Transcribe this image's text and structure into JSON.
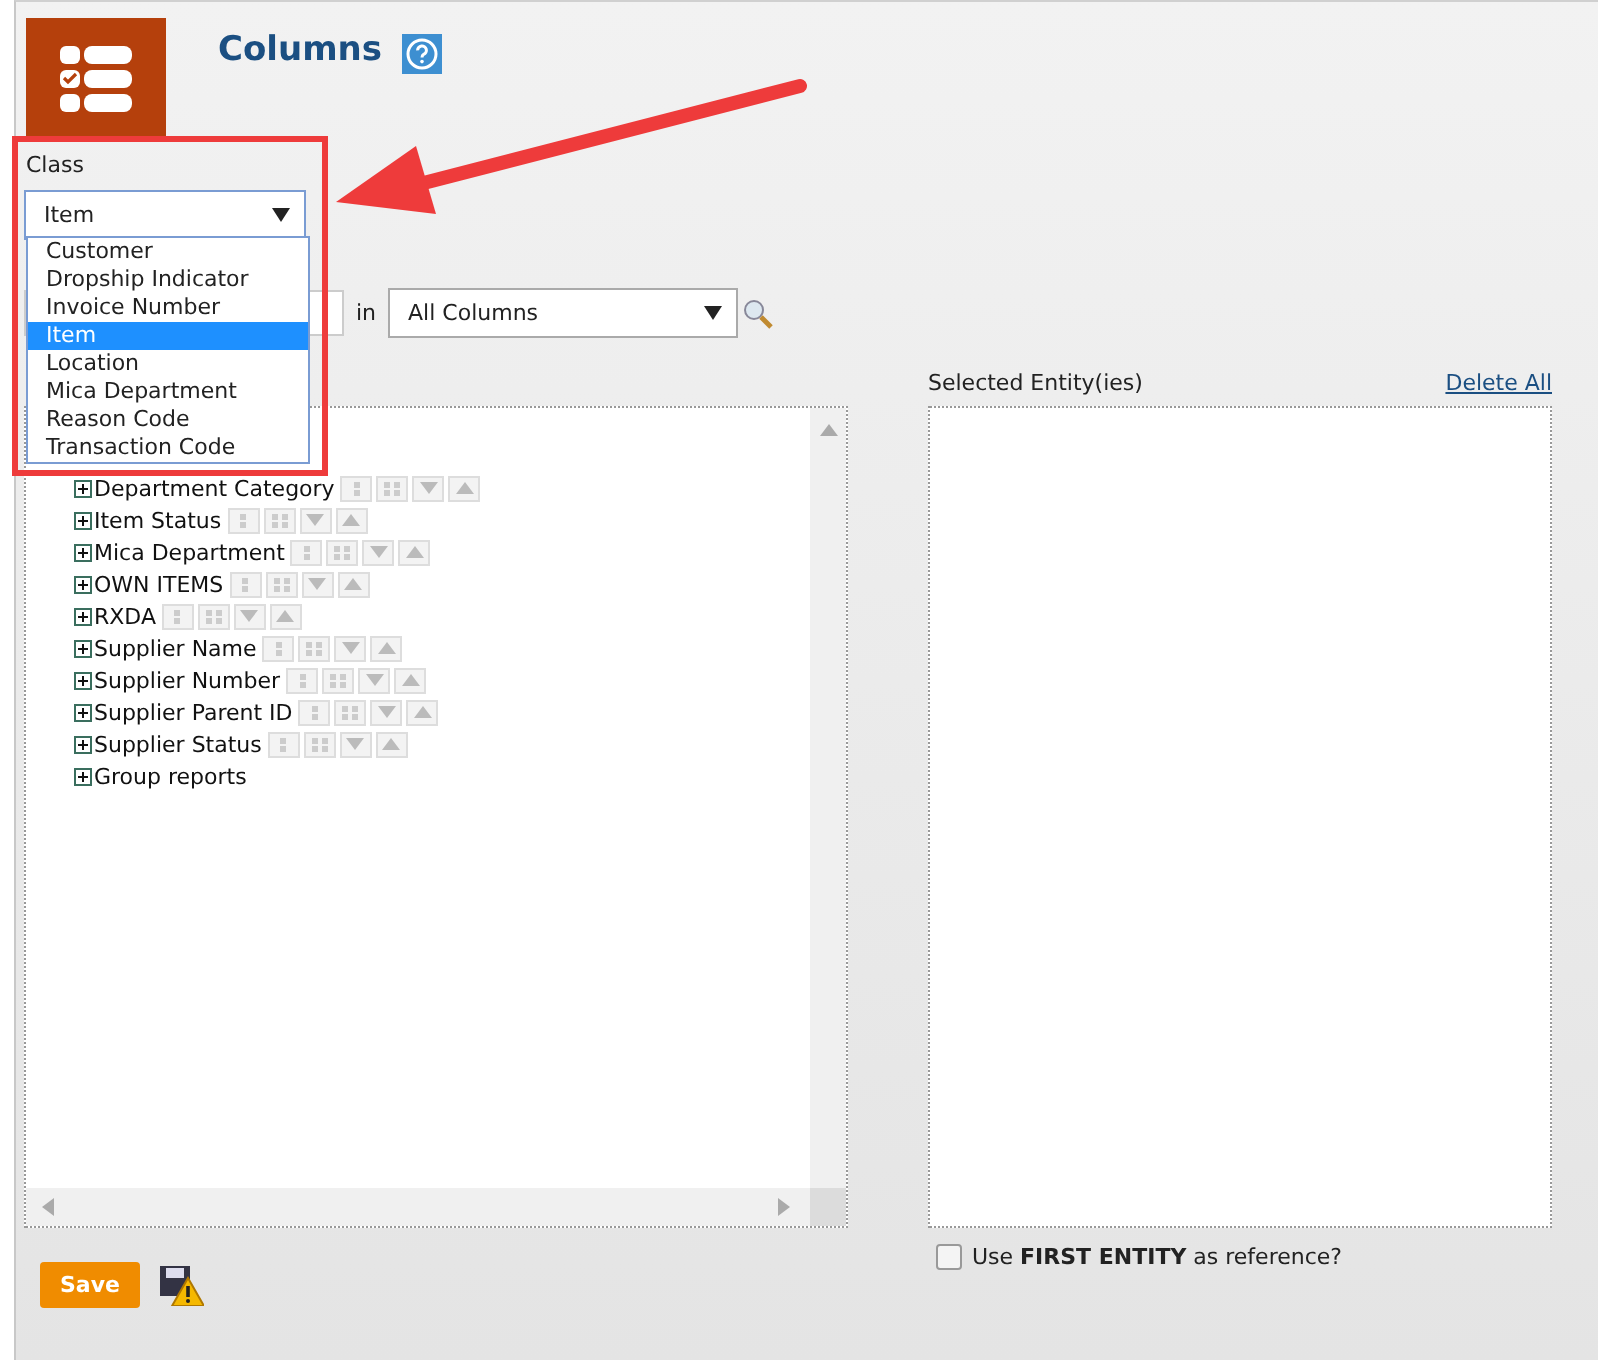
{
  "header": {
    "title": "Columns"
  },
  "class_field": {
    "label": "Class",
    "value": "Item",
    "expanded": true,
    "options": [
      {
        "label": "Customer",
        "selected": false
      },
      {
        "label": "Dropship Indicator",
        "selected": false
      },
      {
        "label": "Invoice Number",
        "selected": false
      },
      {
        "label": "Item",
        "selected": true
      },
      {
        "label": "Location",
        "selected": false
      },
      {
        "label": "Mica Department",
        "selected": false
      },
      {
        "label": "Reason Code",
        "selected": false
      },
      {
        "label": "Transaction Code",
        "selected": false
      }
    ]
  },
  "search": {
    "in_label": "in",
    "scope": "All Columns"
  },
  "tree": [
    {
      "label": "Department Category",
      "tools": true
    },
    {
      "label": "Item Status",
      "tools": true
    },
    {
      "label": "Mica Department",
      "tools": true
    },
    {
      "label": "OWN ITEMS",
      "tools": true
    },
    {
      "label": "RXDA",
      "tools": true
    },
    {
      "label": "Supplier Name",
      "tools": true
    },
    {
      "label": "Supplier Number",
      "tools": true
    },
    {
      "label": "Supplier Parent ID",
      "tools": true
    },
    {
      "label": "Supplier Status",
      "tools": true
    },
    {
      "label": "Group reports",
      "tools": false
    }
  ],
  "selected_panel": {
    "title": "Selected Entity(ies)",
    "delete_all": "Delete All"
  },
  "reference_option": {
    "label": "Use **FIRST ENTITY** as reference?",
    "checked": false
  },
  "save_button": "Save"
}
